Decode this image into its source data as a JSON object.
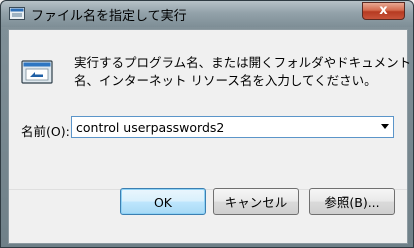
{
  "window": {
    "title": "ファイル名を指定して実行",
    "close_glyph": "x"
  },
  "dialog": {
    "description_line1": "実行するプログラム名、または開くフォルダやドキュメント",
    "description_line2": "名、インターネット リソース名を入力してください。",
    "open_label": "名前(O):",
    "open_value": "control userpasswords2"
  },
  "buttons": {
    "ok": "OK",
    "cancel": "キャンセル",
    "browse": "参照(B)..."
  },
  "colors": {
    "titlebar": "#8e9da5",
    "accent_border": "#5b95c9",
    "close": "#c8533a"
  },
  "icons": [
    "run-app-icon",
    "run-dialog-icon",
    "dropdown-arrow-icon"
  ]
}
